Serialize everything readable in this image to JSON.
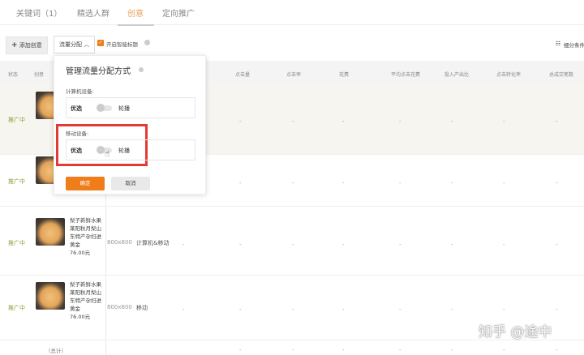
{
  "tabs": [
    {
      "label": "关键词（1）"
    },
    {
      "label": "精选人群"
    },
    {
      "label": "创意"
    },
    {
      "label": "定向推广"
    }
  ],
  "toolbar": {
    "add_label": "添加创意",
    "traffic_label": "流量分配",
    "smart_title_label": "开启智能标题",
    "breakdown_label": "细分条件"
  },
  "table": {
    "headers": [
      "状态",
      "创意",
      "点击量",
      "点击率",
      "花费",
      "平均点击花费",
      "投入产出比",
      "点击转化率",
      "总成交笔数"
    ],
    "rows": [
      {
        "status": "推广中"
      },
      {
        "status": "推广中"
      },
      {
        "status": "推广中",
        "title": "梨子新鲜水果莱阳秋月梨山东特产孕妇进黄金",
        "price": "76.00元",
        "size": "800x800",
        "device": "计算机&移动"
      },
      {
        "status": "推广中",
        "title": "梨子新鲜水果莱阳秋月梨山东特产孕妇进黄金",
        "price": "76.00元",
        "size": "800x800",
        "device": "移动"
      }
    ],
    "total_label": "（总计）",
    "dash": "-"
  },
  "popup": {
    "title": "管理流量分配方式",
    "pc_label": "计算机设备:",
    "mobile_label": "移动设备:",
    "prefer": "优选",
    "rotate": "轮播",
    "confirm": "确定",
    "cancel": "取消"
  },
  "watermark": "知乎 @途中",
  "colors": {
    "accent": "#ee7d1a",
    "highlight": "#e53935"
  }
}
